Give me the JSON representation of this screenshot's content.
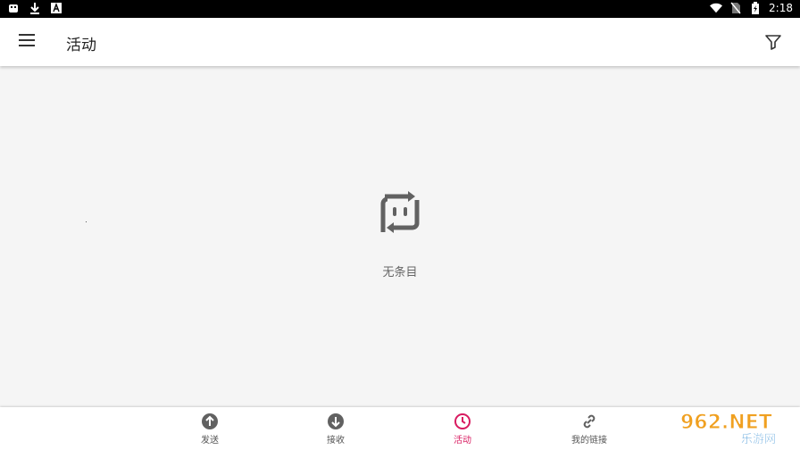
{
  "status_bar": {
    "time": "2:18",
    "left_icons": [
      "bug-icon",
      "download-icon",
      "a-icon"
    ],
    "right_icons": [
      "wifi-icon",
      "no-sim-icon",
      "battery-icon"
    ]
  },
  "app_bar": {
    "title": "活动",
    "menu_icon": "menu-icon",
    "filter_icon": "filter-icon"
  },
  "empty_state": {
    "icon": "chat-sync-icon",
    "label": "无条目"
  },
  "bottom_nav": {
    "items": [
      {
        "label": "发送",
        "icon": "arrow-up-circle-icon",
        "active": false
      },
      {
        "label": "接收",
        "icon": "arrow-down-circle-icon",
        "active": false
      },
      {
        "label": "活动",
        "icon": "clock-icon",
        "active": true
      },
      {
        "label": "我的链接",
        "icon": "link-icon",
        "active": false
      }
    ]
  },
  "watermark": {
    "brand": "962.NET",
    "subtitle": "乐游网"
  },
  "colors": {
    "accent": "#d81b60",
    "icon_gray": "#616161",
    "background": "#f5f5f5"
  }
}
